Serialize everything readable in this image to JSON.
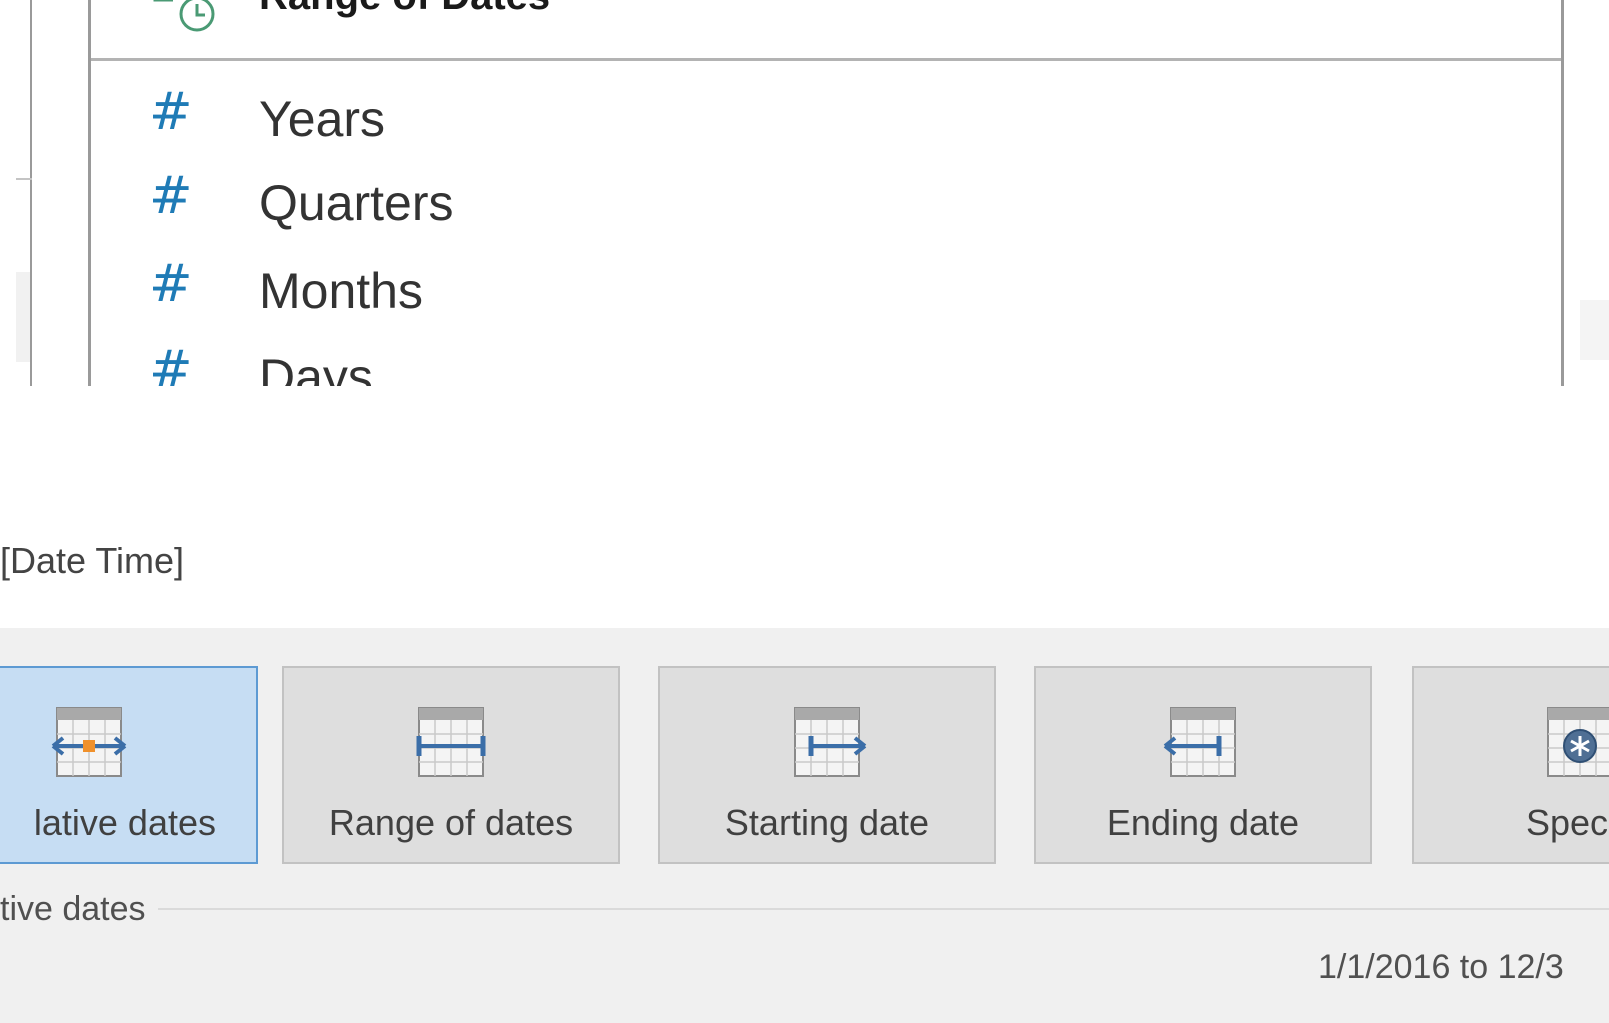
{
  "field_list": {
    "header_label": "Range of Dates",
    "items": [
      {
        "icon": "#",
        "label": "Years"
      },
      {
        "icon": "#",
        "label": "Quarters"
      },
      {
        "icon": "#",
        "label": "Months"
      },
      {
        "icon": "#",
        "label": "Days"
      }
    ]
  },
  "field_caption": "[Date Time]",
  "filter_options": [
    {
      "label": "lative dates",
      "icon": "relative-dates-icon",
      "selected": true
    },
    {
      "label": "Range of dates",
      "icon": "range-of-dates-icon",
      "selected": false
    },
    {
      "label": "Starting date",
      "icon": "starting-date-icon",
      "selected": false
    },
    {
      "label": "Ending date",
      "icon": "ending-date-icon",
      "selected": false
    },
    {
      "label": "Speci",
      "icon": "special-icon",
      "selected": false
    }
  ],
  "section_label": "tive dates",
  "range_summary": "1/1/2016 to 12/3",
  "colors": {
    "accent": "#1f7bb6",
    "selected_fill": "#c6ddf3",
    "selected_border": "#5d9ad3",
    "card_fill": "#dedede",
    "panel_bg": "#f0f0f0"
  }
}
